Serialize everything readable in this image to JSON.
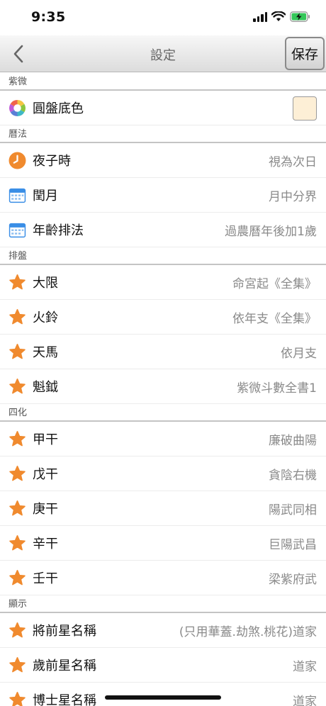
{
  "status_bar": {
    "time": "9:35"
  },
  "nav": {
    "title": "設定",
    "save_label": "保存"
  },
  "sections": [
    {
      "header": "紫微",
      "rows": [
        {
          "label": "圓盤底色",
          "value": "",
          "icon": "color-wheel-icon",
          "swatch": "#fdefd6"
        }
      ]
    },
    {
      "header": "曆法",
      "rows": [
        {
          "label": "夜子時",
          "value": "視為次日",
          "icon": "clock-icon"
        },
        {
          "label": "閏月",
          "value": "月中分界",
          "icon": "calendar-icon"
        },
        {
          "label": "年齡排法",
          "value": "過農曆年後加1歲",
          "icon": "calendar-icon"
        }
      ]
    },
    {
      "header": "排盤",
      "rows": [
        {
          "label": "大限",
          "value": "命宮起《全集》",
          "icon": "star-icon"
        },
        {
          "label": "火鈴",
          "value": "依年支《全集》",
          "icon": "star-icon"
        },
        {
          "label": "天馬",
          "value": "依月支",
          "icon": "star-icon"
        },
        {
          "label": "魁鉞",
          "value": "紫微斗數全書1",
          "icon": "star-icon"
        }
      ]
    },
    {
      "header": "四化",
      "rows": [
        {
          "label": "甲干",
          "value": "廉破曲陽",
          "icon": "star-icon"
        },
        {
          "label": "戊干",
          "value": "貪陰右機",
          "icon": "star-icon"
        },
        {
          "label": "庚干",
          "value": "陽武同相",
          "icon": "star-icon"
        },
        {
          "label": "辛干",
          "value": "巨陽武昌",
          "icon": "star-icon"
        },
        {
          "label": "壬干",
          "value": "梁紫府武",
          "icon": "star-icon"
        }
      ]
    },
    {
      "header": "顯示",
      "rows": [
        {
          "label": "將前星名稱",
          "value": "(只用華蓋.劫煞.桃花)道家",
          "icon": "star-icon"
        },
        {
          "label": "歲前星名稱",
          "value": "道家",
          "icon": "star-icon"
        },
        {
          "label": "博士星名稱",
          "value": "道家",
          "icon": "star-icon"
        }
      ]
    }
  ],
  "colors": {
    "accent": "#f08a2e",
    "calendar_blue": "#3a8ee6"
  }
}
